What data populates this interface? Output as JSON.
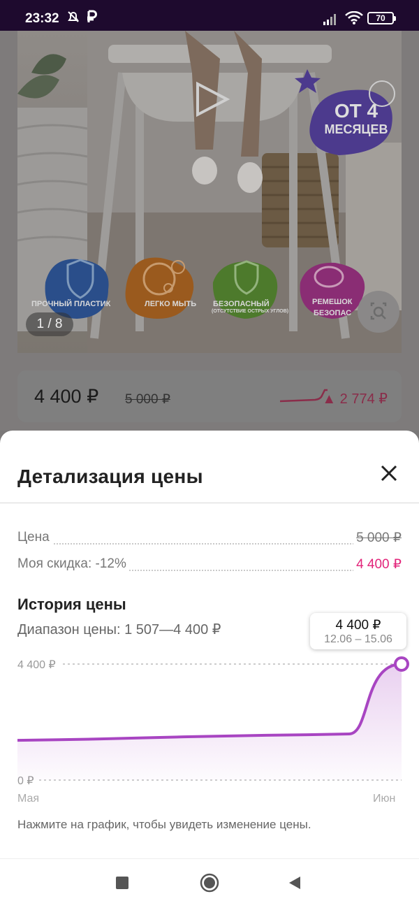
{
  "status_bar": {
    "time": "23:32",
    "battery": "70",
    "icons": [
      "alarm-off-icon",
      "ruble-app-icon",
      "signal-icon",
      "wifi-icon",
      "battery-icon"
    ]
  },
  "product": {
    "age_badge_line1": "ОТ 4",
    "age_badge_line2": "МЕСЯЦЕВ",
    "features": [
      {
        "label": "ПРОЧНЫЙ ПЛАСТИК",
        "icon": "hands-shield-icon"
      },
      {
        "label": "ЛЕГКО МЫТЬ",
        "icon": "bubbles-icon"
      },
      {
        "label": "БЕЗОПАСНЫЙ",
        "sub": "(ОТСУТСТВИЕ ОСТРЫХ УГЛОВ)",
        "icon": "shield-icon"
      },
      {
        "label": "РЕМЕШОК",
        "sub": "БЕЗОПАС",
        "icon": "tape-icon"
      }
    ],
    "pager": "1 / 8"
  },
  "price_card": {
    "current": "4 400 ₽",
    "old": "5 000 ₽",
    "delta": "▲ 2 774 ₽"
  },
  "sheet": {
    "title": "Детализация цены",
    "price_label": "Цена",
    "price_value": "5 000 ₽",
    "discount_label": "Моя скидка: -12%",
    "discount_value": "4 400 ₽",
    "history_title": "История цены",
    "range_text": "Диапазон цены: 1 507—4 400 ₽",
    "hint": "Нажмите на график, чтобы увидеть изменение цены.",
    "colors": {
      "accent": "#a845c2",
      "discount": "#e2247a"
    }
  },
  "chart_data": {
    "type": "area",
    "y_ticks": [
      "4 400 ₽",
      "0 ₽"
    ],
    "x_ticks": [
      "Мая",
      "Июн"
    ],
    "ylim": [
      0,
      4400
    ],
    "series": [
      {
        "values": [
          1507,
          1530,
          1560,
          1600,
          1640,
          1670,
          1700,
          1720,
          1750,
          4400
        ]
      }
    ],
    "tooltip": {
      "value": "4 400 ₽",
      "dates": "12.06 – 15.06"
    }
  },
  "nav": {
    "buttons": [
      "recent-apps-icon",
      "home-icon",
      "back-icon"
    ]
  }
}
